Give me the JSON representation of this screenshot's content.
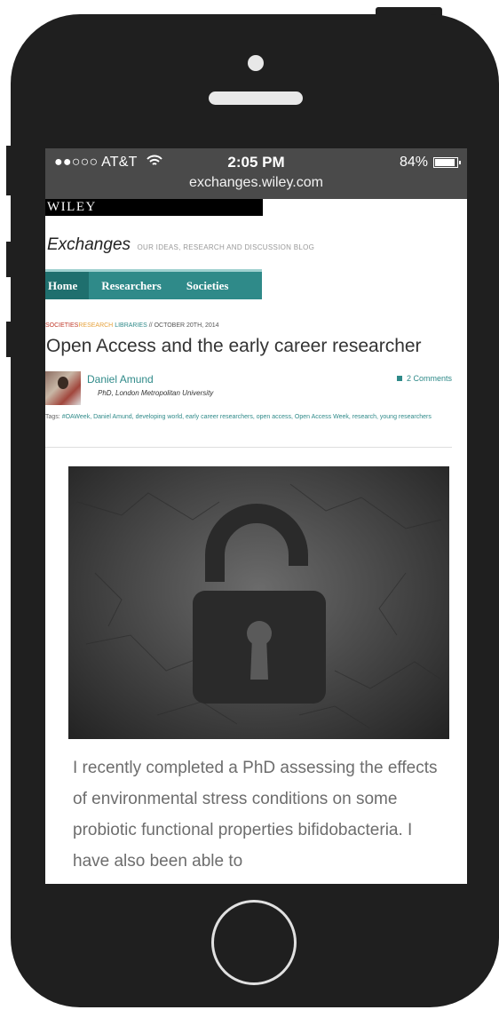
{
  "status_bar": {
    "carrier": "●●○○○ AT&T",
    "time": "2:05 PM",
    "battery": "84%",
    "battery_level": 0.84,
    "url": "exchanges.wiley.com"
  },
  "site": {
    "logo": "WILEY",
    "brand": "Exchanges",
    "tagline": "OUR IDEAS, RESEARCH AND DISCUSSION BLOG"
  },
  "nav": {
    "items": [
      "Home",
      "Researchers",
      "Societies"
    ]
  },
  "article": {
    "categories": {
      "societies": "SOCIETIES",
      "research": "RESEARCH",
      "libraries": "LIBRARIES",
      "date": "// OCTOBER 20TH, 2014"
    },
    "title": "Open Access and the early career researcher",
    "author": {
      "name": "Daniel Amund",
      "affiliation": "PhD, London Metropolitan University"
    },
    "comments": "2 Comments",
    "tags_label": "Tags:",
    "tags": "#OAWeek, Daniel Amund, developing world, early career researchers, open access, Open Access Week, research, young researchers",
    "body": "I recently completed a PhD assessing the effects of environmental stress conditions on some probiotic functional properties bifidobacteria. I have also been able to"
  },
  "icons": [
    "wifi-icon",
    "battery-icon",
    "comment-icon",
    "open-padlock-icon"
  ],
  "colors": {
    "phone": "#1f1f1f",
    "nav_teal": "#2f8a89",
    "status_bar": "#4a4a4a"
  }
}
